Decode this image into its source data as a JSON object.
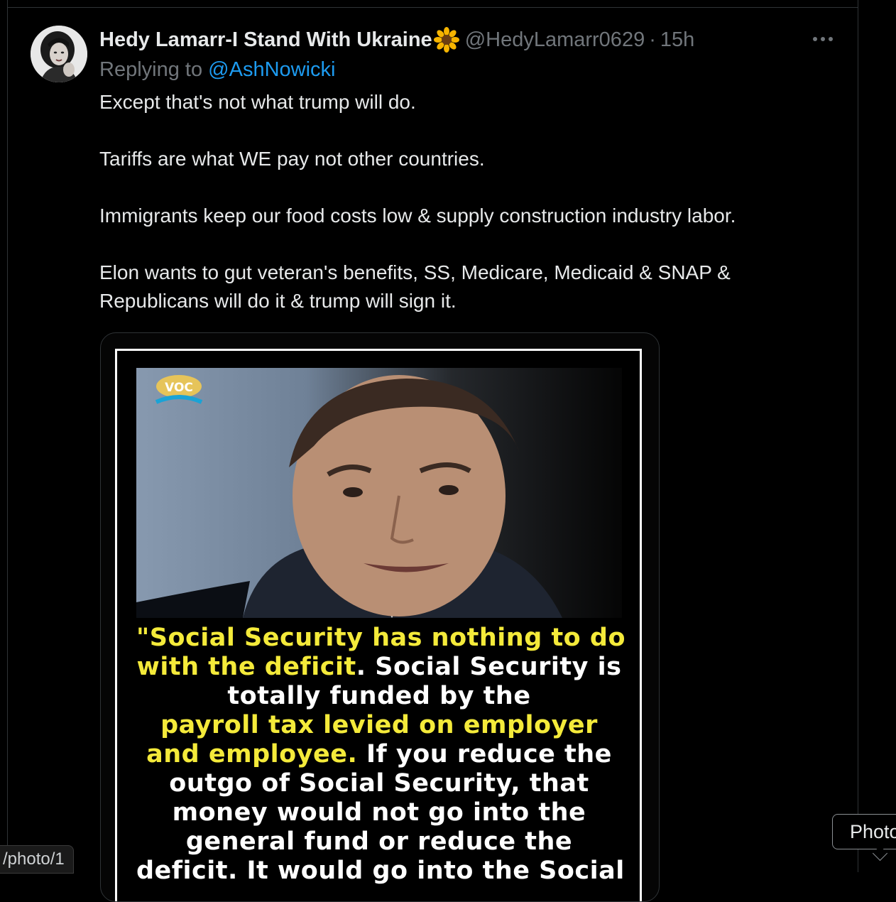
{
  "tweet": {
    "display_name": "Hedy Lamarr-I Stand With Ukraine",
    "name_emoji": "sunflower-icon",
    "handle": "@HedyLamarr0629",
    "separator": "·",
    "time": "15h",
    "replying_prefix": "Replying to",
    "replying_to": "@AshNowicki",
    "paragraphs": [
      "Except that's not what trump will do.",
      "Tariffs are what WE pay not other countries.",
      "Immigrants keep our food costs low & supply construction industry labor.",
      "Elon wants to gut veteran's benefits, SS, Medicare, Medicaid & SNAP & Republicans will do it & trump will sign it."
    ]
  },
  "media": {
    "logo_text": "VOC",
    "quote_lines": [
      [
        "\"Social Security has nothing to do",
        ""
      ],
      [
        "with the deficit",
        ". Social Security is"
      ],
      [
        "",
        "totally funded by the"
      ],
      [
        "payroll tax levied on employer",
        ""
      ],
      [
        "and employee.",
        " If you reduce the"
      ],
      [
        "",
        "outgo of Social Security, that"
      ],
      [
        "",
        "money would not go into the"
      ],
      [
        "",
        "general fund or reduce the"
      ],
      [
        "",
        "deficit. It would go into the Social"
      ]
    ],
    "highlight_color": "#f4ea3a"
  },
  "browser": {
    "status_url": "/photo/1",
    "tooltip": "Photo"
  },
  "colors": {
    "background": "#000000",
    "text_primary": "#e7e9ea",
    "text_secondary": "#71767b",
    "link": "#1d9bf0",
    "border": "#2f3336"
  }
}
